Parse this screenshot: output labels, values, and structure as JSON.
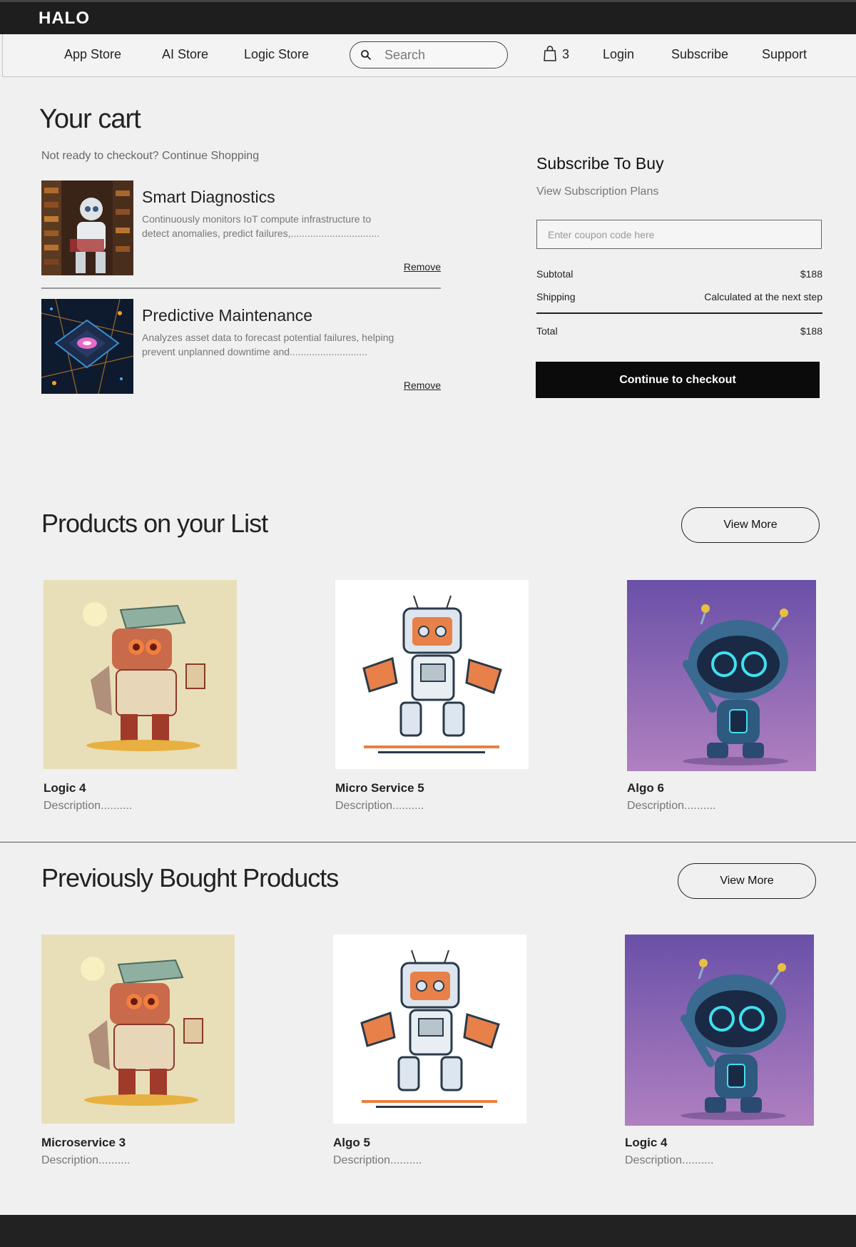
{
  "brand": "HALO",
  "nav": {
    "links": [
      "App Store",
      "AI Store",
      "Logic Store"
    ],
    "search_placeholder": "Search",
    "cart_count": "3",
    "login": "Login",
    "subscribe": "Subscribe",
    "support": "Support"
  },
  "cart": {
    "title": "Your cart",
    "subtitle": "Not ready to checkout? Continue Shopping",
    "items": [
      {
        "name": "Smart Diagnostics",
        "description": "Continuously monitors IoT compute infrastructure to detect anomalies, predict failures,................................",
        "remove": "Remove",
        "image": "robot-reading-in-library"
      },
      {
        "name": "Predictive Maintenance",
        "description": "Analyzes asset data to forecast potential failures, helping prevent unplanned downtime and............................",
        "remove": "Remove",
        "image": "glowing-processor-chip"
      }
    ]
  },
  "summary": {
    "title": "Subscribe To Buy",
    "plans_link": "View Subscription Plans",
    "coupon_placeholder": "Enter coupon code here",
    "subtotal_label": "Subtotal",
    "subtotal_value": "$188",
    "shipping_label": "Shipping",
    "shipping_value": "Calculated at the next step",
    "total_label": "Total",
    "total_value": "$188",
    "checkout_label": "Continue to checkout"
  },
  "list_section": {
    "title": "Products on your List",
    "view_more": "View More",
    "products": [
      {
        "name": "Logic 4",
        "description": "Description..........",
        "image": "red-solar-robot"
      },
      {
        "name": "Micro Service 5",
        "description": "Description..........",
        "image": "orange-sketch-robot"
      },
      {
        "name": "Algo 6",
        "description": "Description..........",
        "image": "blue-round-robot"
      }
    ]
  },
  "bought_section": {
    "title": "Previously Bought Products",
    "view_more": "View More",
    "products": [
      {
        "name": "Microservice 3",
        "description": "Description..........",
        "image": "red-solar-robot"
      },
      {
        "name": "Algo 5",
        "description": "Description..........",
        "image": "orange-sketch-robot"
      },
      {
        "name": "Logic 4",
        "description": "Description..........",
        "image": "blue-round-robot"
      }
    ]
  },
  "colors": {
    "header_bg": "#1e1e1e",
    "page_bg": "#f0f0f0",
    "checkout_bg": "#0b0b0b",
    "muted_text": "#777777"
  }
}
